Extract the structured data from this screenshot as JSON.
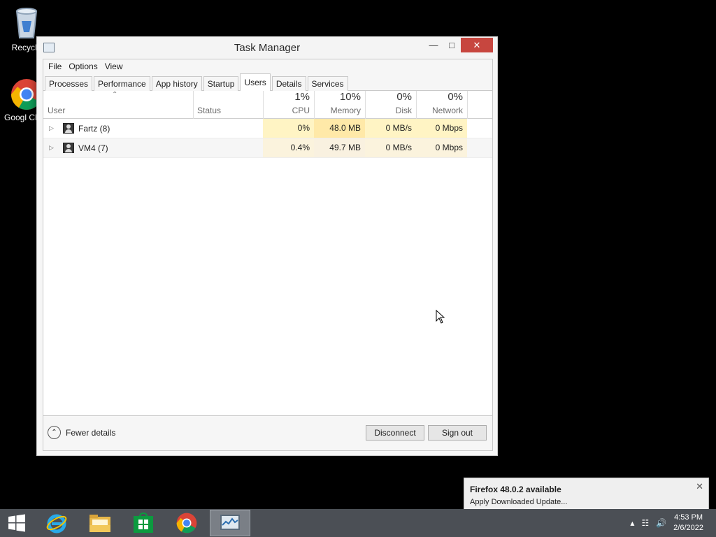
{
  "desktop": {
    "icons": [
      {
        "label": "Recycle"
      },
      {
        "label": "Googl Chrom"
      }
    ]
  },
  "window": {
    "title": "Task Manager",
    "menu": [
      "File",
      "Options",
      "View"
    ],
    "tabs": [
      "Processes",
      "Performance",
      "App history",
      "Startup",
      "Users",
      "Details",
      "Services"
    ],
    "active_tab": "Users",
    "columns": {
      "user": "User",
      "status": "Status",
      "cpu": {
        "pct": "1%",
        "name": "CPU"
      },
      "memory": {
        "pct": "10%",
        "name": "Memory"
      },
      "disk": {
        "pct": "0%",
        "name": "Disk"
      },
      "network": {
        "pct": "0%",
        "name": "Network"
      }
    },
    "rows": [
      {
        "user": "Fartz (8)",
        "status": "",
        "cpu": "0%",
        "memory": "48.0 MB",
        "disk": "0 MB/s",
        "network": "0 Mbps"
      },
      {
        "user": "VM4 (7)",
        "status": "",
        "cpu": "0.4%",
        "memory": "49.7 MB",
        "disk": "0 MB/s",
        "network": "0 Mbps"
      }
    ],
    "footer": {
      "fewer_details": "Fewer details",
      "disconnect": "Disconnect",
      "sign_out": "Sign out"
    }
  },
  "notification": {
    "title": "Firefox 48.0.2 available",
    "body": "Apply Downloaded Update..."
  },
  "taskbar": {
    "time": "4:53 PM",
    "date": "2/6/2022"
  },
  "colors": {
    "close_button": "#c7463f",
    "highlight_light": "#fff4c4",
    "highlight_strong": "#ffe9a8",
    "taskbar": "#4b4f55"
  }
}
